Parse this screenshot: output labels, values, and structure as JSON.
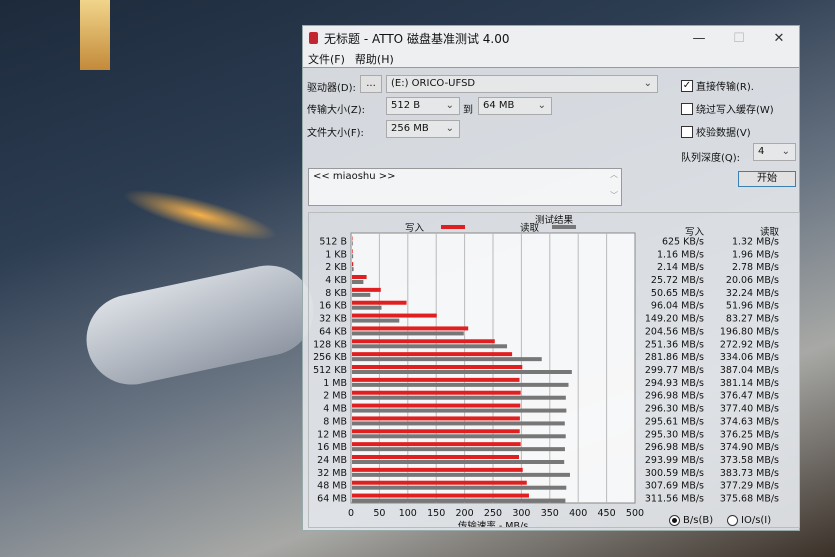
{
  "window": {
    "title": "无标题 - ATTO 磁盘基准测试 4.00",
    "minimize": "—",
    "maximize": "☐",
    "close": "✕"
  },
  "menu": [
    "文件(F)",
    "帮助(H)"
  ],
  "form": {
    "drive_label": "驱动器(D):",
    "browse": "...",
    "drive_value": "(E:) ORICO-UFSD",
    "transfer_label": "传输大小(Z):",
    "transfer_from": "512 B",
    "to_label": "到",
    "transfer_to": "64 MB",
    "file_label": "文件大小(F):",
    "file_value": "256 MB",
    "direct_io": {
      "label": "直接传输(R).",
      "checked": true
    },
    "bypass_cache": {
      "label": "绕过写入缓存(W)",
      "checked": false
    },
    "verify": {
      "label": "校验数据(V)",
      "checked": false
    },
    "queue_label": "队列深度(Q):",
    "queue_value": "4",
    "start": "开始",
    "description": "<< miaoshu >>"
  },
  "results": {
    "title": "测试结果",
    "write_header": "写入",
    "read_header": "读取",
    "write": [
      "625 KB/s",
      "1.16 MB/s",
      "2.14 MB/s",
      "25.72 MB/s",
      "50.65 MB/s",
      "96.04 MB/s",
      "149.20 MB/s",
      "204.56 MB/s",
      "251.36 MB/s",
      "281.86 MB/s",
      "299.77 MB/s",
      "294.93 MB/s",
      "296.98 MB/s",
      "296.30 MB/s",
      "295.61 MB/s",
      "295.30 MB/s",
      "296.98 MB/s",
      "293.99 MB/s",
      "300.59 MB/s",
      "307.69 MB/s",
      "311.56 MB/s"
    ],
    "read": [
      "1.32 MB/s",
      "1.96 MB/s",
      "2.78 MB/s",
      "20.06 MB/s",
      "32.24 MB/s",
      "51.96 MB/s",
      "83.27 MB/s",
      "196.80 MB/s",
      "272.92 MB/s",
      "334.06 MB/s",
      "387.04 MB/s",
      "381.14 MB/s",
      "376.47 MB/s",
      "377.40 MB/s",
      "374.63 MB/s",
      "376.25 MB/s",
      "374.90 MB/s",
      "373.58 MB/s",
      "383.73 MB/s",
      "377.29 MB/s",
      "375.68 MB/s"
    ],
    "unit_bytes": "B/s(B)",
    "unit_io": "IO/s(I)",
    "unit_selected": "bytes"
  },
  "chart_data": {
    "type": "bar",
    "orientation": "horizontal",
    "categories": [
      "512 B",
      "1 KB",
      "2 KB",
      "4 KB",
      "8 KB",
      "16 KB",
      "32 KB",
      "64 KB",
      "128 KB",
      "256 KB",
      "512 KB",
      "1 MB",
      "2 MB",
      "4 MB",
      "8 MB",
      "12 MB",
      "16 MB",
      "24 MB",
      "32 MB",
      "48 MB",
      "64 MB"
    ],
    "series": [
      {
        "name": "写入",
        "color": "#e02020",
        "values": [
          0.61,
          1.16,
          2.14,
          25.72,
          50.65,
          96.04,
          149.2,
          204.56,
          251.36,
          281.86,
          299.77,
          294.93,
          296.98,
          296.3,
          295.61,
          295.3,
          296.98,
          293.99,
          300.59,
          307.69,
          311.56
        ]
      },
      {
        "name": "读取",
        "color": "#777777",
        "values": [
          1.32,
          1.96,
          2.78,
          20.06,
          32.24,
          51.96,
          83.27,
          196.8,
          272.92,
          334.06,
          387.04,
          381.14,
          376.47,
          377.4,
          374.63,
          376.25,
          374.9,
          373.58,
          383.73,
          377.29,
          375.68
        ]
      }
    ],
    "xlabel": "传输速率 - MB/s",
    "xlim": [
      0,
      500
    ],
    "xticks": [
      0,
      50,
      100,
      150,
      200,
      250,
      300,
      350,
      400,
      450,
      500
    ],
    "grid": true,
    "legend": "top"
  }
}
